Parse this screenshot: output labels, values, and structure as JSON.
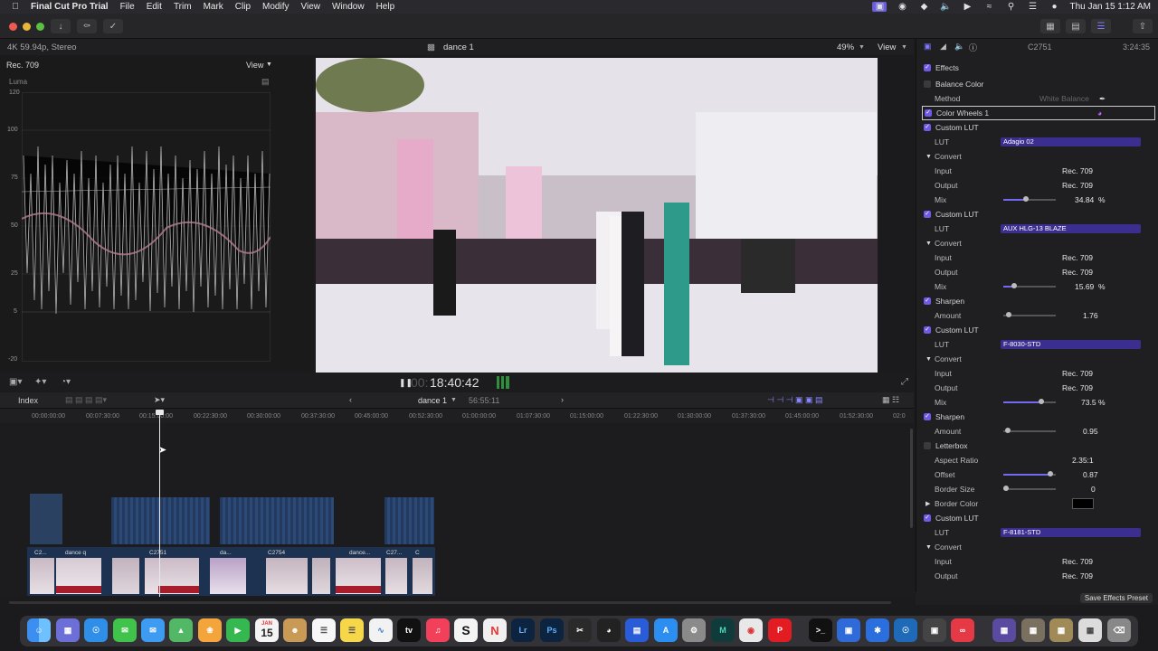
{
  "menubar": {
    "app": "Final Cut Pro Trial",
    "items": [
      "File",
      "Edit",
      "Trim",
      "Mark",
      "Clip",
      "Modify",
      "View",
      "Window",
      "Help"
    ],
    "clock": "Thu Jan 15  1:12 AM"
  },
  "viewer": {
    "format": "4K 59.94p, Stereo",
    "title": "dance 1",
    "zoom": "49%",
    "view": "View",
    "timecode_prefix": "00:",
    "timecode": "18:40:42"
  },
  "scope": {
    "colorspace": "Rec. 709",
    "view": "View",
    "label": "Luma",
    "ticks": [
      "120",
      "100",
      "75",
      "50",
      "25",
      "5",
      "-20"
    ]
  },
  "timeline": {
    "index": "Index",
    "project": "dance 1",
    "duration": "56:55:11",
    "ruler": [
      "00:00:00:00",
      "00:07:30:00",
      "00:15:00:00",
      "00:22:30:00",
      "00:30:00:00",
      "00:37:30:00",
      "00:45:00:00",
      "00:52:30:00",
      "01:00:00:00",
      "01:07:30:00",
      "01:15:00:00",
      "01:22:30:00",
      "01:30:00:00",
      "01:37:30:00",
      "01:45:00:00",
      "01:52:30:00",
      "02:0"
    ],
    "clips": [
      "C2...",
      "dance q",
      "C2751",
      "da...",
      "C2754",
      "dance...",
      "C27...",
      "C"
    ]
  },
  "inspector": {
    "clip": "C2751",
    "duration": "3:24:35",
    "effects": "Effects",
    "balance_color": "Balance Color",
    "method_label": "Method",
    "method_value": "White Balance",
    "color_wheels": "Color Wheels 1",
    "rows": {
      "custom_lut": "Custom LUT",
      "lut": "LUT",
      "convert": "Convert",
      "input": "Input",
      "output": "Output",
      "mix": "Mix",
      "sharpen": "Sharpen",
      "amount": "Amount",
      "letterbox": "Letterbox",
      "aspect_ratio": "Aspect Ratio",
      "offset": "Offset",
      "border_size": "Border Size",
      "border_color": "Border Color",
      "rec709": "Rec. 709",
      "pct": "%"
    },
    "lut1": "Adagio 02",
    "mix1": "34.84",
    "lut2": "AUX HLG-13 BLAZE",
    "mix2": "15.69",
    "sharpen1": "1.76",
    "lut3": "F-8030-STD",
    "mix3": "73.5",
    "sharpen2": "0.95",
    "aspect": "2.35:1",
    "offset": "0.87",
    "border_size": "0",
    "lut4": "F-8181-STD",
    "save_preset": "Save Effects Preset"
  },
  "dock": {
    "calendar_day": "15",
    "calendar_month": "JAN"
  },
  "colors": {
    "accent": "#6f59e6",
    "clip_blue": "#2d4b7a"
  }
}
